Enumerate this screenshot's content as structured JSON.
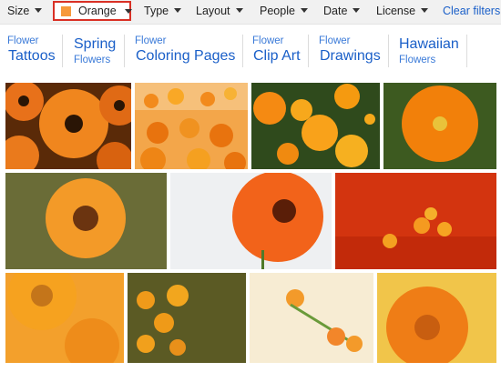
{
  "filters": {
    "size": "Size",
    "color": "Orange",
    "type": "Type",
    "layout": "Layout",
    "people": "People",
    "date": "Date",
    "license": "License",
    "clear": "Clear filters",
    "color_swatch": "#f6993b"
  },
  "suggestions": [
    {
      "small": "Flower",
      "big": "Tattoos"
    },
    {
      "big": "Spring",
      "small": "Flowers"
    },
    {
      "small": "Flower",
      "big": "Coloring Pages"
    },
    {
      "small": "Flower",
      "big": "Clip Art"
    },
    {
      "small": "Flower",
      "big": "Drawings"
    },
    {
      "big": "Hawaiian",
      "small": "Flowers"
    }
  ],
  "colors": {
    "accent_link": "#1a5fc8",
    "selected_border": "#d93025",
    "filter_bar_bg": "#f1f1f1"
  }
}
